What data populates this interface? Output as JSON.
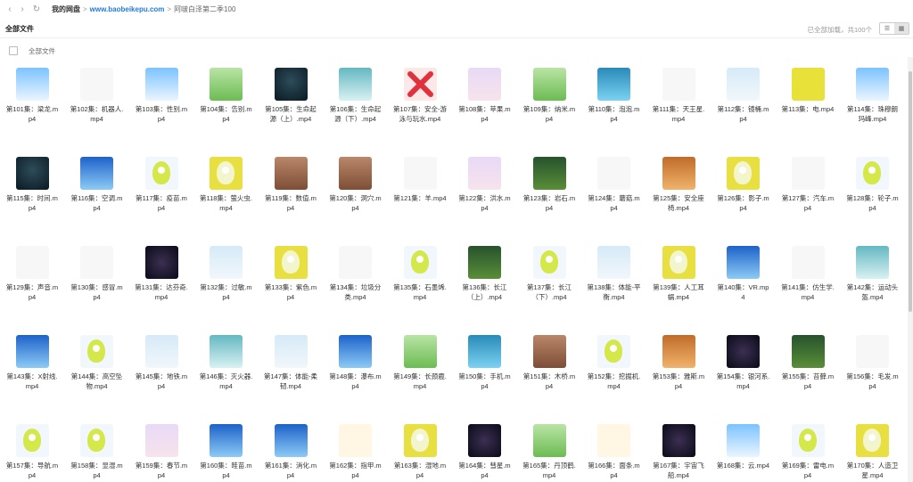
{
  "nav": {
    "back_icon": "‹",
    "forward_icon": "›",
    "refresh_icon": "↻",
    "crumb_root": "我的网盘",
    "crumb_sep1": ">",
    "crumb_link": "www.baobeikepu.com",
    "crumb_sep2": ">",
    "crumb_last": "阿啵白泽第二季100"
  },
  "section": {
    "title": "全部文件",
    "status": "已全部加载，共100个",
    "list_view_icon": "☰",
    "grid_view_icon": "▦"
  },
  "select_all_label": "全部文件",
  "files": [
    {
      "name": "第101集：梁龙.mp4",
      "thumb": "sky"
    },
    {
      "name": "第102集：机器人.mp4",
      "thumb": "white"
    },
    {
      "name": "第103集：性别.mp4",
      "thumb": "sky"
    },
    {
      "name": "第104集：告别.mp4",
      "thumb": "green"
    },
    {
      "name": "第105集：生命起源（上）.mp4",
      "thumb": "dark"
    },
    {
      "name": "第106集：生命起源（下）.mp4",
      "thumb": "teal"
    },
    {
      "name": "第107集：安全-游泳与玩水.mp4",
      "thumb": "x"
    },
    {
      "name": "第108集：苹果.mp4",
      "thumb": "pink"
    },
    {
      "name": "第109集：纳米.mp4",
      "thumb": "green"
    },
    {
      "name": "第110集：泡泡.mp4",
      "thumb": "water"
    },
    {
      "name": "第111集：天王星.mp4",
      "thumb": "white"
    },
    {
      "name": "第112集：镜桶.mp4",
      "thumb": "mist"
    },
    {
      "name": "第113集：电.mp4",
      "thumb": "yellow"
    },
    {
      "name": "第114集：珠穆朗玛峰.mp4",
      "thumb": "sky"
    },
    {
      "name": "第115集：时间.mp4",
      "thumb": "dark"
    },
    {
      "name": "第116集：空调.mp4",
      "thumb": "blue"
    },
    {
      "name": "第117集：疫苗.mp4",
      "thumb": "mascot"
    },
    {
      "name": "第118集：萤火虫.mp4",
      "thumb": "mascot-yellow"
    },
    {
      "name": "第119集：数值.mp4",
      "thumb": "brown"
    },
    {
      "name": "第120集：洞穴.mp4",
      "thumb": "brown"
    },
    {
      "name": "第121集：羊.mp4",
      "thumb": "white"
    },
    {
      "name": "第122集：洪水.mp4",
      "thumb": "pink"
    },
    {
      "name": "第123集：岩石.mp4",
      "thumb": "forest"
    },
    {
      "name": "第124集：蘑菇.mp4",
      "thumb": "white"
    },
    {
      "name": "第125集：安全座椅.mp4",
      "thumb": "orange"
    },
    {
      "name": "第126集：影子.mp4",
      "thumb": "mascot-yellow"
    },
    {
      "name": "第127集：汽车.mp4",
      "thumb": "white"
    },
    {
      "name": "第128集：轮子.mp4",
      "thumb": "mascot"
    },
    {
      "name": "第129集：声音.mp4",
      "thumb": "white"
    },
    {
      "name": "第130集：感冒.mp4",
      "thumb": "white"
    },
    {
      "name": "第131集：达芬奇.mp4",
      "thumb": "night"
    },
    {
      "name": "第132集：过敏.mp4",
      "thumb": "mist"
    },
    {
      "name": "第133集：紫色.mp4",
      "thumb": "mascot-yellow"
    },
    {
      "name": "第134集：垃圾分类.mp4",
      "thumb": "white"
    },
    {
      "name": "第135集：石墨烯.mp4",
      "thumb": "mascot"
    },
    {
      "name": "第136集：长江（上）.mp4",
      "thumb": "forest"
    },
    {
      "name": "第137集：长江（下）.mp4",
      "thumb": "mascot"
    },
    {
      "name": "第138集：体能-平衡.mp4",
      "thumb": "mist"
    },
    {
      "name": "第139集：人工耳蜗.mp4",
      "thumb": "mascot-yellow"
    },
    {
      "name": "第140集：VR.mp4",
      "thumb": "blue"
    },
    {
      "name": "第141集：仿生学.mp4",
      "thumb": "white"
    },
    {
      "name": "第142集：运动头盔.mp4",
      "thumb": "teal"
    },
    {
      "name": "第143集：X射线.mp4",
      "thumb": "blue"
    },
    {
      "name": "第144集：高空坠物.mp4",
      "thumb": "mascot"
    },
    {
      "name": "第145集：地铁.mp4",
      "thumb": "mist"
    },
    {
      "name": "第146集：灭火器.mp4",
      "thumb": "teal"
    },
    {
      "name": "第147集：体能-柔韧.mp4",
      "thumb": "mist"
    },
    {
      "name": "第148集：瀑布.mp4",
      "thumb": "blue"
    },
    {
      "name": "第149集：长颈鹿.mp4",
      "thumb": "green"
    },
    {
      "name": "第150集：手机.mp4",
      "thumb": "water"
    },
    {
      "name": "第151集：木桥.mp4",
      "thumb": "brown"
    },
    {
      "name": "第152集：挖掘机.mp4",
      "thumb": "mascot"
    },
    {
      "name": "第153集：雅斯.mp4",
      "thumb": "orange"
    },
    {
      "name": "第154集：银河系.mp4",
      "thumb": "night"
    },
    {
      "name": "第155集：苔藓.mp4",
      "thumb": "forest"
    },
    {
      "name": "第156集：毛发.mp4",
      "thumb": "white"
    },
    {
      "name": "第157集：导航.mp4",
      "thumb": "mascot"
    },
    {
      "name": "第158集：显湿.mp4",
      "thumb": "mascot"
    },
    {
      "name": "第159集：春节.mp4",
      "thumb": "pink"
    },
    {
      "name": "第160集：畦苗.mp4",
      "thumb": "blue"
    },
    {
      "name": "第161集：消化.mp4",
      "thumb": "blue"
    },
    {
      "name": "第162集：指甲.mp4",
      "thumb": "cream"
    },
    {
      "name": "第163集：湿地.mp4",
      "thumb": "mascot-yellow"
    },
    {
      "name": "第164集：彗星.mp4",
      "thumb": "night"
    },
    {
      "name": "第165集：丹顶鹤.mp4",
      "thumb": "green"
    },
    {
      "name": "第166集：面条.mp4",
      "thumb": "cream"
    },
    {
      "name": "第167集：宇宙飞船.mp4",
      "thumb": "night"
    },
    {
      "name": "第168集：云.mp4",
      "thumb": "sky"
    },
    {
      "name": "第169集：雷电.mp4",
      "thumb": "mascot"
    },
    {
      "name": "第170集：人造卫星.mp4",
      "thumb": "mascot-yellow"
    }
  ]
}
